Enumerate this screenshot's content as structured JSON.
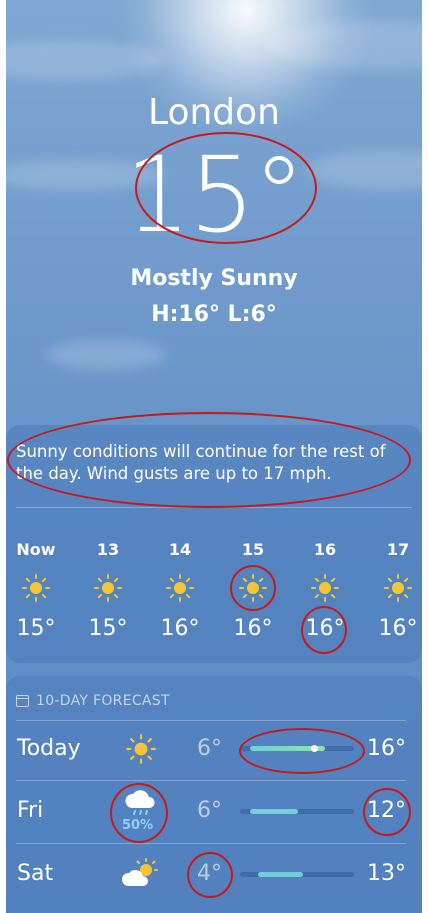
{
  "location": "London",
  "current_temp": "15°",
  "condition": "Mostly Sunny",
  "high_low": "H:16°  L:6°",
  "summary": "Sunny conditions will continue for the rest of the day. Wind gusts are up to 17 mph.",
  "hourly": [
    {
      "label": "Now",
      "icon": "sun-icon",
      "temp": "15°"
    },
    {
      "label": "13",
      "icon": "sun-icon",
      "temp": "15°"
    },
    {
      "label": "14",
      "icon": "sun-icon",
      "temp": "16°"
    },
    {
      "label": "15",
      "icon": "sun-icon",
      "temp": "16°"
    },
    {
      "label": "16",
      "icon": "sun-icon",
      "temp": "16°"
    },
    {
      "label": "17",
      "icon": "sun-icon",
      "temp": "16°"
    }
  ],
  "forecast_title": "10-DAY FORECAST",
  "forecast": [
    {
      "day": "Today",
      "icon": "sun-icon",
      "low": "6°",
      "high": "16°",
      "precip": ""
    },
    {
      "day": "Fri",
      "icon": "cloud-rain-icon",
      "low": "6°",
      "high": "12°",
      "precip": "50%"
    },
    {
      "day": "Sat",
      "icon": "cloud-sun-icon",
      "low": "4°",
      "high": "13°",
      "precip": ""
    }
  ],
  "colors": {
    "annotation_ring": "#C41A1A",
    "sun": "#F7C531",
    "bar_today": "#7ED9C7",
    "bar_fri": "#74CFD6",
    "bar_sat": "#72CCE0"
  }
}
